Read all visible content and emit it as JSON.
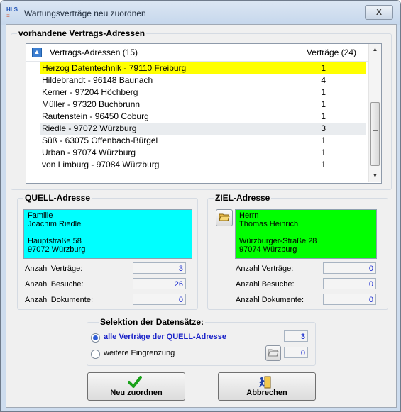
{
  "window": {
    "title": "Wartungsverträge neu zuordnen",
    "app_icon_text_top": "HLS",
    "app_icon_text_bottom": "≡",
    "close_symbol": "X"
  },
  "addresses_group": {
    "label": "vorhandene Vertrags-Adressen",
    "header": {
      "col1": "Vertrags-Adressen (15)",
      "col2": "Verträge (24)"
    },
    "rows": [
      {
        "name": "Herzog Datentechnik - 79110 Freiburg",
        "count": "1",
        "state": "selected"
      },
      {
        "name": "Hildebrandt - 96148 Baunach",
        "count": "4",
        "state": ""
      },
      {
        "name": "Kerner - 97204 Höchberg",
        "count": "1",
        "state": ""
      },
      {
        "name": "Müller - 97320 Buchbrunn",
        "count": "1",
        "state": ""
      },
      {
        "name": "Rautenstein - 96450 Coburg",
        "count": "1",
        "state": ""
      },
      {
        "name": "Riedle - 97072 Würzburg",
        "count": "3",
        "state": "hover"
      },
      {
        "name": "Süß - 63075 Offenbach-Bürgel",
        "count": "1",
        "state": ""
      },
      {
        "name": "Urban - 97074 Würzburg",
        "count": "1",
        "state": ""
      },
      {
        "name": "von Limburg - 97084 Würzburg",
        "count": "1",
        "state": ""
      }
    ]
  },
  "source": {
    "label": "QUELL-Adresse",
    "lines": [
      "Familie",
      "Joachim Riedle",
      "",
      "Hauptstraße 58",
      "97072 Würzburg"
    ],
    "bg_color": "#00ffff",
    "contracts_label": "Anzahl Verträge:",
    "contracts": "3",
    "visits_label": "Anzahl Besuche:",
    "visits": "26",
    "docs_label": "Anzahl Dokumente:",
    "docs": "0"
  },
  "target": {
    "label": "ZIEL-Adresse",
    "lines": [
      "Herrn",
      "Thomas Heinrich",
      "",
      "Würzburger-Straße 28",
      "97074 Würzburg"
    ],
    "bg_color": "#00ff00",
    "contracts_label": "Anzahl Verträge:",
    "contracts": "0",
    "visits_label": "Anzahl Besuche:",
    "visits": "0",
    "docs_label": "Anzahl Dokumente:",
    "docs": "0"
  },
  "selection": {
    "label": "Selektion der Datensätze:",
    "option_all": "alle Verträge der QUELL-Adresse",
    "option_all_count": "3",
    "option_more": "weitere Eingrenzung",
    "option_more_count": "0"
  },
  "buttons": {
    "reassign": "Neu zuordnen",
    "cancel": "Abbrechen"
  },
  "colors": {
    "highlight": "#ffff00",
    "value_text": "#1a2dd0",
    "accent_green": "#1aa21a"
  }
}
